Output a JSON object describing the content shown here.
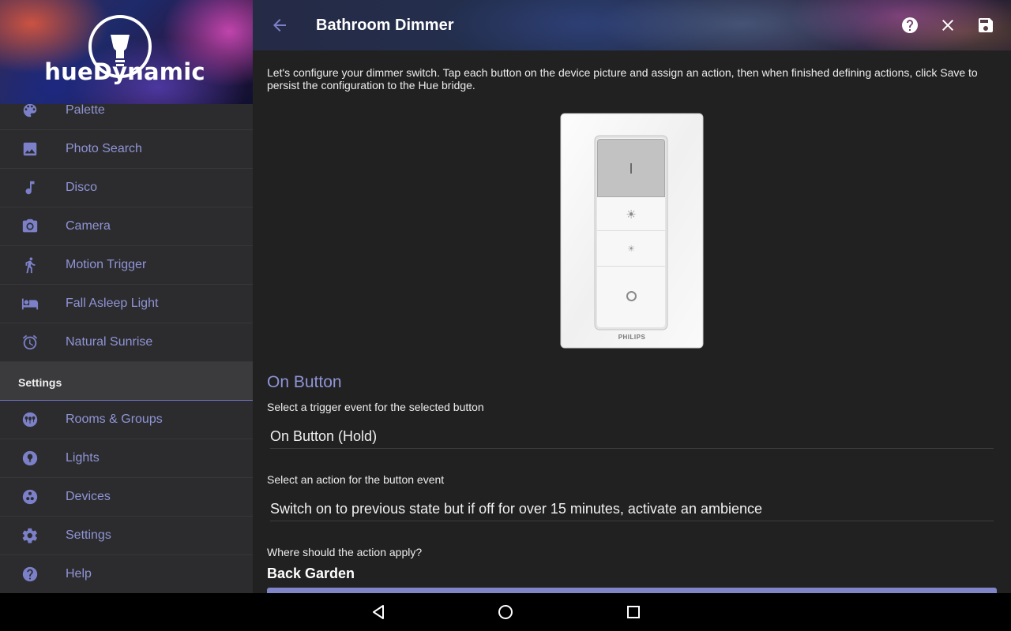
{
  "brand": {
    "name": "hueDynamic",
    "logo_icon": "bulb-icon"
  },
  "sidebar": {
    "items": [
      {
        "label": "Palette",
        "icon": "palette-icon"
      },
      {
        "label": "Photo Search",
        "icon": "image-icon"
      },
      {
        "label": "Disco",
        "icon": "music-note-icon"
      },
      {
        "label": "Camera",
        "icon": "camera-icon"
      },
      {
        "label": "Motion Trigger",
        "icon": "walking-person-icon"
      },
      {
        "label": "Fall Asleep Light",
        "icon": "bed-icon"
      },
      {
        "label": "Natural Sunrise",
        "icon": "alarm-clock-icon"
      }
    ],
    "section_header": "Settings",
    "settings_items": [
      {
        "label": "Rooms & Groups",
        "icon": "group-bulbs-icon"
      },
      {
        "label": "Lights",
        "icon": "bulb-icon"
      },
      {
        "label": "Devices",
        "icon": "devices-icon"
      },
      {
        "label": "Settings",
        "icon": "gear-icon"
      },
      {
        "label": "Help",
        "icon": "help-icon"
      }
    ],
    "accent_color": "#8f94d6"
  },
  "header": {
    "title": "Bathroom Dimmer",
    "actions": [
      "help-icon",
      "close-icon",
      "save-icon"
    ]
  },
  "main": {
    "intro": "Let's configure your dimmer switch. Tap each button on the device picture and assign an action, then when finished defining actions, click Save to persist the configuration to the Hue bridge.",
    "device": {
      "brand_label": "PHILIPS",
      "buttons": [
        "on",
        "brighten",
        "dim",
        "off"
      ]
    },
    "section_title": "On Button",
    "trigger_label": "Select a trigger event for the selected button",
    "trigger_value": "On Button (Hold)",
    "action_label": "Select an action for the button event",
    "action_value": "Switch on to previous state but if off for over 15 minutes, activate an ambience",
    "apply_label": "Where should the action apply?",
    "apply_value": "Back Garden"
  },
  "system_nav": [
    "back-triangle-icon",
    "home-circle-icon",
    "recents-square-icon"
  ]
}
